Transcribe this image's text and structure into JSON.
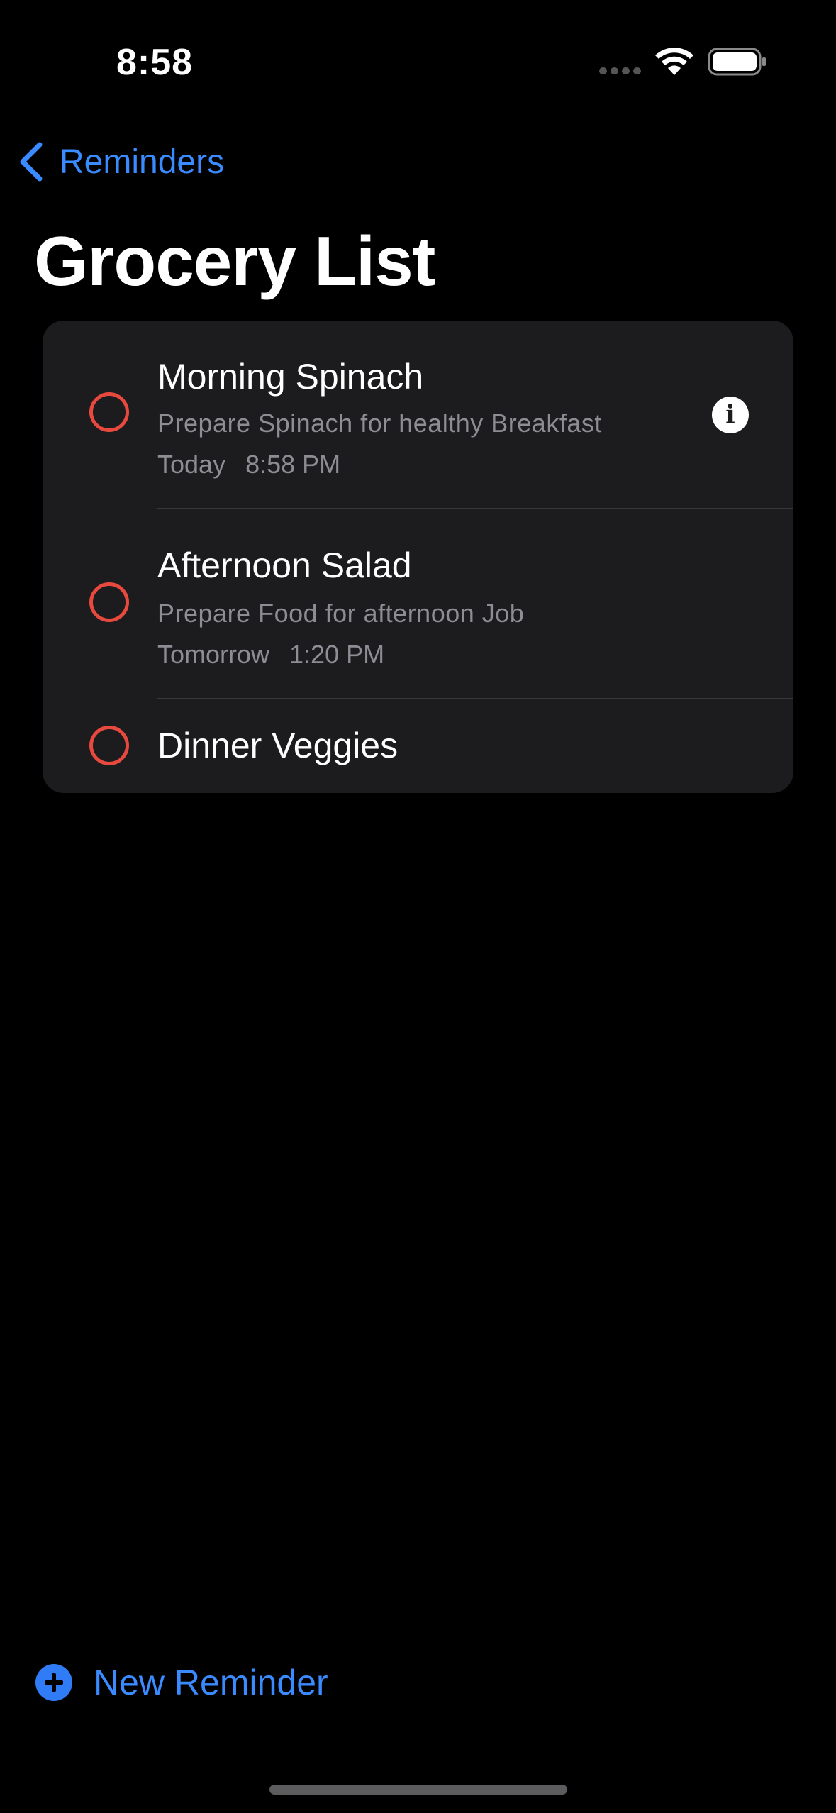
{
  "status_bar": {
    "time": "8:58"
  },
  "nav": {
    "back_label": "Reminders",
    "title": "Grocery List"
  },
  "reminders": [
    {
      "title": "Morning Spinach",
      "notes": "Prepare Spinach for healthy Breakfast",
      "date": "Today",
      "time": "8:58 PM",
      "selected": true
    },
    {
      "title": "Afternoon Salad",
      "notes": "Prepare Food for afternoon Job",
      "date": "Tomorrow",
      "time": "1:20 PM"
    },
    {
      "title": "Dinner Veggies"
    }
  ],
  "footer": {
    "new_reminder_label": "New Reminder"
  },
  "colors": {
    "accent": "#3a8bff",
    "circle": "#e8493e",
    "card": "#1c1c1e",
    "secondary_text": "#8d8d93"
  },
  "icons": {
    "back": "chevron-left-icon",
    "info": "info-icon",
    "add": "plus-circle-icon",
    "wifi": "wifi-icon",
    "battery": "battery-icon"
  }
}
